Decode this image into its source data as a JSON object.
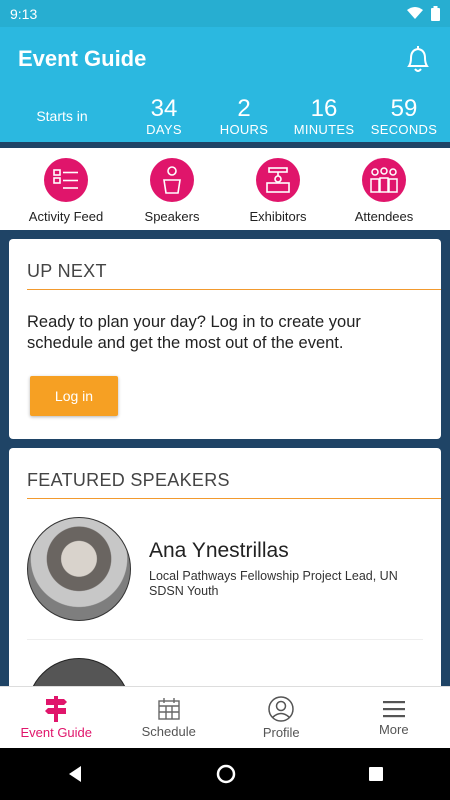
{
  "status": {
    "time": "9:13"
  },
  "header": {
    "title": "Event Guide"
  },
  "countdown": {
    "starts_in": "Starts in",
    "units": [
      {
        "value": "34",
        "label": "DAYS"
      },
      {
        "value": "2",
        "label": "HOURS"
      },
      {
        "value": "16",
        "label": "MINUTES"
      },
      {
        "value": "59",
        "label": "SECONDS"
      }
    ]
  },
  "quicknav": [
    {
      "label": "Activity Feed",
      "icon": "activity-feed-icon"
    },
    {
      "label": "Speakers",
      "icon": "speaker-podium-icon"
    },
    {
      "label": "Exhibitors",
      "icon": "exhibitor-booth-icon"
    },
    {
      "label": "Attendees",
      "icon": "attendees-group-icon"
    }
  ],
  "up_next": {
    "title": "UP NEXT",
    "text": "Ready to plan your day? Log in to create your schedule and get the most out of the event.",
    "button": "Log in"
  },
  "featured_speakers": {
    "title": "FEATURED SPEAKERS",
    "speakers": [
      {
        "name": "Ana Ynestrillas",
        "role": "Local Pathways Fellowship Project Lead, UN SDSN Youth"
      }
    ]
  },
  "bottom_nav": [
    {
      "label": "Event Guide",
      "icon": "signpost-icon",
      "active": true
    },
    {
      "label": "Schedule",
      "icon": "calendar-icon",
      "active": false
    },
    {
      "label": "Profile",
      "icon": "profile-icon",
      "active": false
    },
    {
      "label": "More",
      "icon": "menu-icon",
      "active": false
    }
  ],
  "colors": {
    "header": "#2bb8e0",
    "accent": "#e0156b",
    "button": "#f6a023",
    "background": "#1f4466"
  }
}
